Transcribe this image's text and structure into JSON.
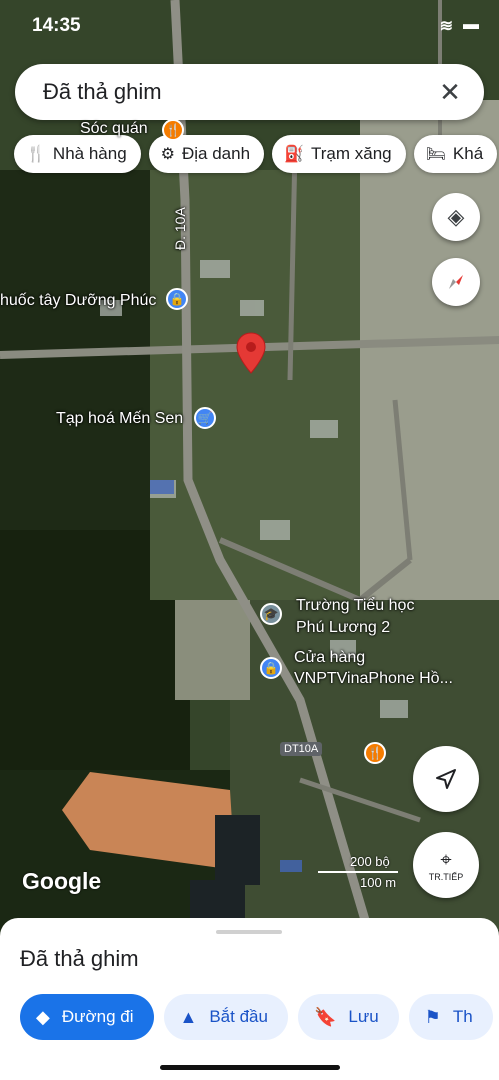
{
  "status": {
    "time": "14:35",
    "signal": "wifi",
    "battery": "battery"
  },
  "search": {
    "query": "Đã thả ghim",
    "close": "✕"
  },
  "chips": [
    {
      "icon": "restaurant-icon",
      "label": "Nhà hàng"
    },
    {
      "icon": "landmark-icon",
      "label": "Địa danh"
    },
    {
      "icon": "gas-station-icon",
      "label": "Trạm xăng"
    },
    {
      "icon": "hotel-icon",
      "label": "Khá"
    }
  ],
  "map": {
    "labels": {
      "soc_quan": "Sóc quán",
      "road_10a": "Đ. 10A",
      "pharmacy": "huốc tây Dưỡng Phúc",
      "shop": "Tạp hoá Mến Sen",
      "school_1": "Trường Tiểu học",
      "school_2": "Phú Lương 2",
      "vnpt_1": "Cửa hàng",
      "vnpt_2": "VNPTVinaPhone Hồ...",
      "dt10a": "DT10A"
    },
    "scale": {
      "ft": "200 bộ",
      "m": "100 m"
    },
    "brand": "Google",
    "nav_label": "TR.TIẾP",
    "pin_color": "#e53935"
  },
  "sheet": {
    "title": "Đã thả ghim",
    "actions": [
      {
        "icon": "directions-icon",
        "label": "Đường đi"
      },
      {
        "icon": "navigation-start-icon",
        "label": "Bắt đầu"
      },
      {
        "icon": "bookmark-icon",
        "label": "Lưu"
      },
      {
        "icon": "flag-icon",
        "label": "Th"
      }
    ]
  }
}
